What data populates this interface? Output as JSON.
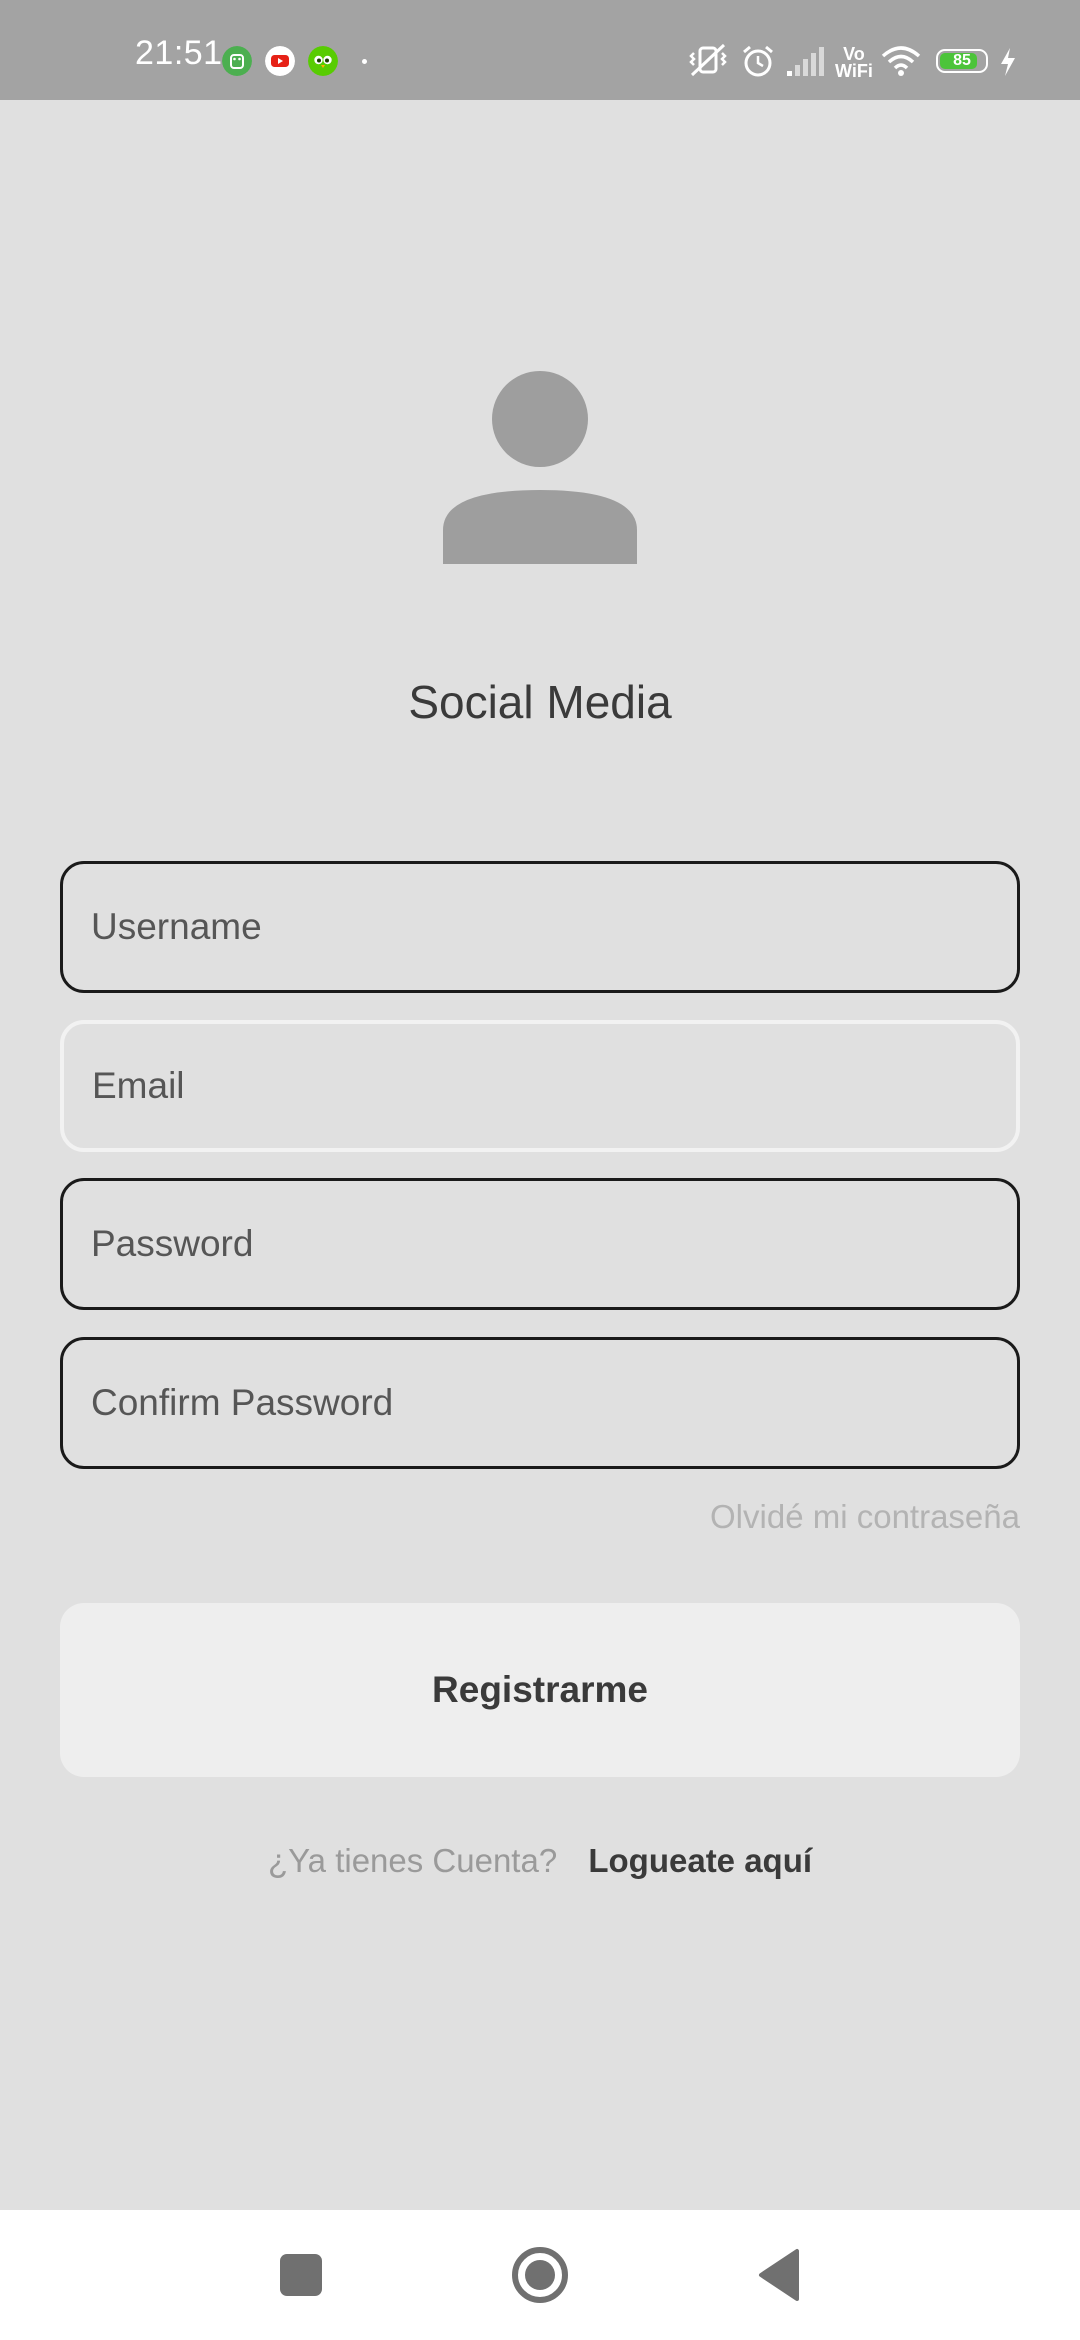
{
  "status_bar": {
    "time": "21:51",
    "battery_level": "85",
    "battery_fraction": 0.85,
    "vowifi_top": "Vo",
    "vowifi_bottom": "WiFi",
    "icons": [
      "android-debug-icon",
      "youtube-icon",
      "duolingo-icon",
      "vibrate-off-icon",
      "alarm-icon",
      "signal-icon",
      "vowifi-icon",
      "wifi-icon",
      "battery-icon",
      "charging-icon"
    ]
  },
  "header": {
    "avatar_icon": "person-icon",
    "title": "Social Media"
  },
  "form": {
    "username_placeholder": "Username",
    "email_placeholder": "Email",
    "password_placeholder": "Password",
    "confirm_password_placeholder": "Confirm Password",
    "forgot_password": "Olvidé mi contraseña",
    "register_button": "Registrarme"
  },
  "footer": {
    "login_prompt": "¿Ya tienes Cuenta?",
    "login_link": "Logueate aquí"
  },
  "nav_bar": {
    "icons": [
      "recents-square-icon",
      "home-circle-icon",
      "back-triangle-icon"
    ]
  },
  "colors": {
    "background": "#e0e0e0",
    "status_bar": "#a3a3a3",
    "icon_gray": "#9e9e9e",
    "text_dark": "#3a3a3a",
    "button_bg": "#eeeeee",
    "battery_green": "#4cc43a"
  }
}
